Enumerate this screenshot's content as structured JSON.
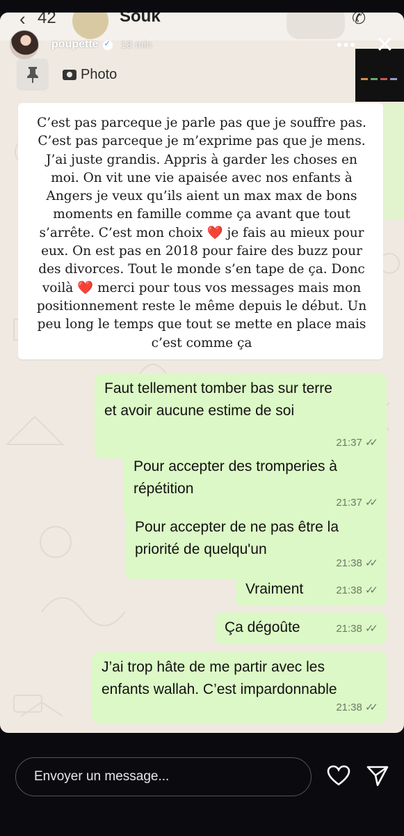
{
  "background_header": {
    "back_count": "42",
    "chat_name": "Souk"
  },
  "story": {
    "username": "poupette",
    "time_ago": "18 min",
    "more": "•••",
    "pinned_label": "Photo"
  },
  "quote_lines": [
    "C’est pas parceque je parle pas que je souffre pas.",
    "C’est pas parceque je m’exprime pas que je mens.",
    "J’ai juste grandis. Appris à garder les choses en",
    "moi. On vit une vie apaisée avec nos enfants à",
    "Angers je veux qu’ils aient un max max de bons",
    "moments en famille comme ça avant que tout",
    "s’arrête. C’est mon choix ❤️ je fais au mieux pour",
    "eux. On est pas en 2018 pour faire des buzz pour",
    "des divorces. Tout le monde s’en tape de ça. Donc",
    "voilà ❤️ merci pour tous vos messages mais mon",
    "positionnement reste le même depuis le début. Un",
    "peu long le temps que tout se mette en place mais",
    "c’est comme ça"
  ],
  "messages": [
    {
      "text_line1": "Faut tellement tomber bas sur terre",
      "text_line2": "et avoir aucune estime de soi",
      "time": "21:37"
    },
    {
      "text_line1": "Pour accepter des tromperies à",
      "text_line2": "répétition",
      "time": "21:37"
    },
    {
      "text_line1": "Pour accepter de ne pas être la",
      "text_line2": "priorité de quelqu'un",
      "time": "21:38"
    },
    {
      "text_line1": "Vraiment",
      "time": "21:38"
    },
    {
      "text_line1": "Ça dégoûte",
      "time": "21:38"
    },
    {
      "text_line1": "J’ai trop hâte de me partir avec les",
      "text_line2": "enfants wallah. C’est impardonnable",
      "time": "21:38"
    }
  ],
  "reply": {
    "placeholder": "Envoyer un message..."
  },
  "colors": {
    "bubble_green": "#dcf8c6",
    "chat_background": "#efe9e1",
    "app_background": "#0b0b0f"
  }
}
